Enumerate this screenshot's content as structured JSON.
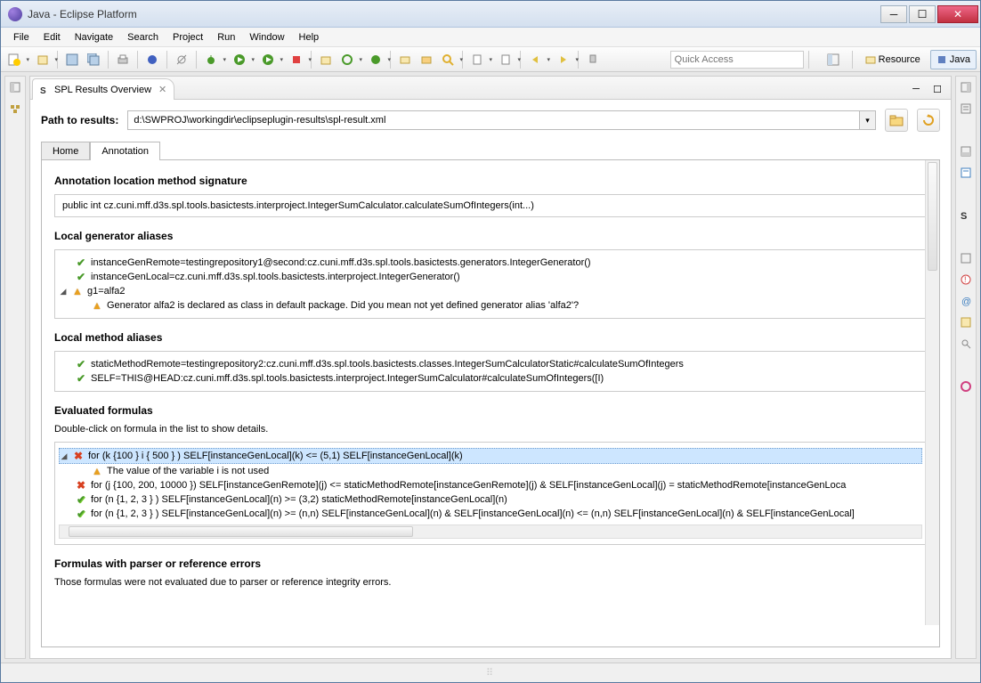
{
  "window": {
    "title": "Java - Eclipse Platform"
  },
  "menu": [
    "File",
    "Edit",
    "Navigate",
    "Search",
    "Project",
    "Run",
    "Window",
    "Help"
  ],
  "quick_access_placeholder": "Quick Access",
  "perspectives": {
    "resource": "Resource",
    "java": "Java"
  },
  "view": {
    "tab_title": "SPL Results Overview"
  },
  "path": {
    "label": "Path to results:",
    "value": "d:\\SWPROJ\\workingdir\\eclipseplugin-results\\spl-result.xml"
  },
  "tabs": {
    "home": "Home",
    "annotation": "Annotation"
  },
  "sections": {
    "sig_title": "Annotation location method signature",
    "sig_value": "public int cz.cuni.mff.d3s.spl.tools.basictests.interproject.IntegerSumCalculator.calculateSumOfIntegers(int...)",
    "gen_title": "Local generator aliases",
    "gen_items": [
      {
        "status": "ok",
        "text": "instanceGenRemote=testingrepository1@second:cz.cuni.mff.d3s.spl.tools.basictests.generators.IntegerGenerator()"
      },
      {
        "status": "ok",
        "text": "instanceGenLocal=cz.cuni.mff.d3s.spl.tools.basictests.interproject.IntegerGenerator()"
      },
      {
        "status": "warn",
        "text": "g1=alfa2",
        "expandable": true,
        "children": [
          {
            "status": "warn",
            "text": "Generator alfa2 is declared as class in default package. Did you mean not yet defined generator alias 'alfa2'?"
          }
        ]
      }
    ],
    "meth_title": "Local method aliases",
    "meth_items": [
      {
        "status": "ok",
        "text": "staticMethodRemote=testingrepository2:cz.cuni.mff.d3s.spl.tools.basictests.classes.IntegerSumCalculatorStatic#calculateSumOfIntegers"
      },
      {
        "status": "ok",
        "text": "SELF=THIS@HEAD:cz.cuni.mff.d3s.spl.tools.basictests.interproject.IntegerSumCalculator#calculateSumOfIntegers([I)"
      }
    ],
    "formulas_title": "Evaluated formulas",
    "formulas_hint": "Double-click on formula in the list to show details.",
    "formulas": [
      {
        "status": "err",
        "expandable": true,
        "selected": true,
        "text": "for (k {100 } i { 500 } ) SELF[instanceGenLocal](k) <= (5,1) SELF[instanceGenLocal](k)",
        "children": [
          {
            "status": "warn",
            "text": "The value of the variable i is not used"
          }
        ]
      },
      {
        "status": "err",
        "text": "for (j {100, 200, 10000 }) SELF[instanceGenRemote](j) <= staticMethodRemote[instanceGenRemote](j) & SELF[instanceGenLocal](j) = staticMethodRemote[instanceGenLoca"
      },
      {
        "status": "okdbl",
        "text": "for (n {1, 2, 3 } ) SELF[instanceGenLocal](n) >= (3,2) staticMethodRemote[instanceGenLocal](n)"
      },
      {
        "status": "okdbl",
        "text": "for (n {1, 2, 3 } ) SELF[instanceGenLocal](n) >= (n,n) SELF[instanceGenLocal](n) & SELF[instanceGenLocal](n) <= (n,n) SELF[instanceGenLocal](n) & SELF[instanceGenLocal]"
      }
    ],
    "errors_title": "Formulas with parser or reference errors",
    "errors_hint": "Those formulas were not evaluated due to parser or reference integrity errors."
  }
}
